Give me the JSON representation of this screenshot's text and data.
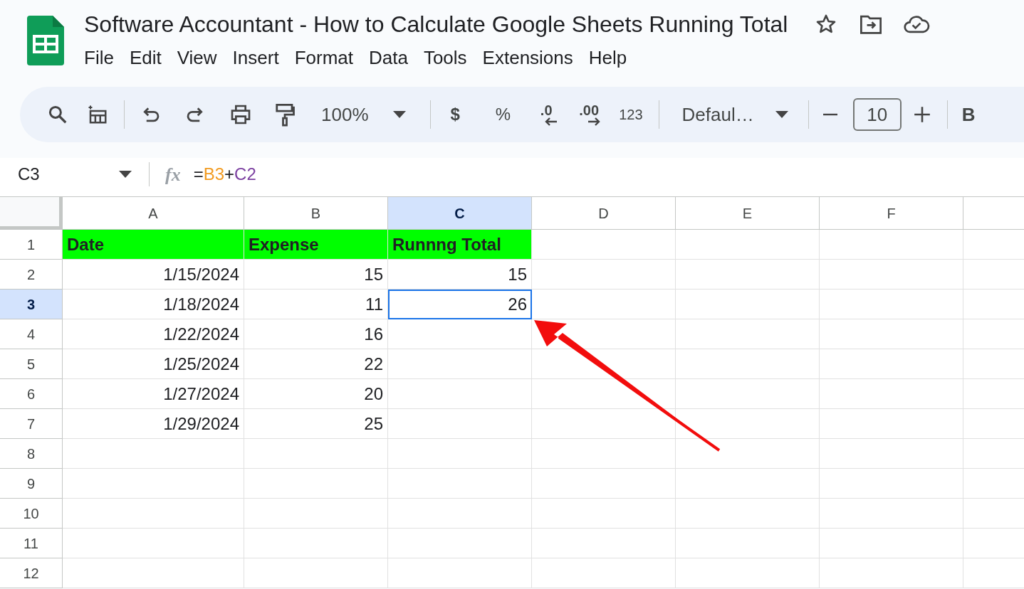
{
  "window": {
    "title": "Software Accountant - How to Calculate Google Sheets Running Total"
  },
  "menu": [
    "File",
    "Edit",
    "View",
    "Insert",
    "Format",
    "Data",
    "Tools",
    "Extensions",
    "Help"
  ],
  "toolbar": {
    "zoom": "100%",
    "currency": "$",
    "percent": "%",
    "decrease_decimal": ".0",
    "increase_decimal": ".00",
    "number_format": "123",
    "font": "Defaul…",
    "font_size": "10",
    "bold": "B"
  },
  "formula_bar": {
    "name_box": "C3",
    "fx": "fx",
    "tokens": [
      {
        "text": "=",
        "color": "#202124"
      },
      {
        "text": "B3",
        "color": "#f29b21"
      },
      {
        "text": "+",
        "color": "#202124"
      },
      {
        "text": "C2",
        "color": "#7b3fa0"
      }
    ]
  },
  "grid": {
    "columns": [
      {
        "label": "A",
        "selected": false
      },
      {
        "label": "B",
        "selected": false
      },
      {
        "label": "C",
        "selected": true
      },
      {
        "label": "D",
        "selected": false
      },
      {
        "label": "E",
        "selected": false
      },
      {
        "label": "F",
        "selected": false
      }
    ],
    "rows": [
      {
        "label": "1",
        "selected": false,
        "kind": "header",
        "cells": [
          {
            "text": "Date",
            "selected": false
          },
          {
            "text": "Expense",
            "selected": false
          },
          {
            "text": "Runnng Total",
            "selected": false
          }
        ]
      },
      {
        "label": "2",
        "selected": false,
        "kind": "data",
        "cells": [
          {
            "text": "1/15/2024",
            "selected": false
          },
          {
            "text": "15",
            "selected": false
          },
          {
            "text": "15",
            "selected": false
          }
        ]
      },
      {
        "label": "3",
        "selected": true,
        "kind": "data",
        "cells": [
          {
            "text": "1/18/2024",
            "selected": false
          },
          {
            "text": "11",
            "selected": false
          },
          {
            "text": "26",
            "selected": true
          }
        ]
      },
      {
        "label": "4",
        "selected": false,
        "kind": "data",
        "cells": [
          {
            "text": "1/22/2024",
            "selected": false
          },
          {
            "text": "16",
            "selected": false
          }
        ]
      },
      {
        "label": "5",
        "selected": false,
        "kind": "data",
        "cells": [
          {
            "text": "1/25/2024",
            "selected": false
          },
          {
            "text": "22",
            "selected": false
          }
        ]
      },
      {
        "label": "6",
        "selected": false,
        "kind": "data",
        "cells": [
          {
            "text": "1/27/2024",
            "selected": false
          },
          {
            "text": "20",
            "selected": false
          }
        ]
      },
      {
        "label": "7",
        "selected": false,
        "kind": "data",
        "cells": [
          {
            "text": "1/29/2024",
            "selected": false
          },
          {
            "text": "25",
            "selected": false
          }
        ]
      },
      {
        "label": "8",
        "selected": false,
        "kind": "data",
        "cells": []
      },
      {
        "label": "9",
        "selected": false,
        "kind": "data",
        "cells": []
      },
      {
        "label": "10",
        "selected": false,
        "kind": "data",
        "cells": []
      },
      {
        "label": "11",
        "selected": false,
        "kind": "data",
        "cells": []
      },
      {
        "label": "12",
        "selected": false,
        "kind": "data",
        "cells": []
      }
    ]
  }
}
